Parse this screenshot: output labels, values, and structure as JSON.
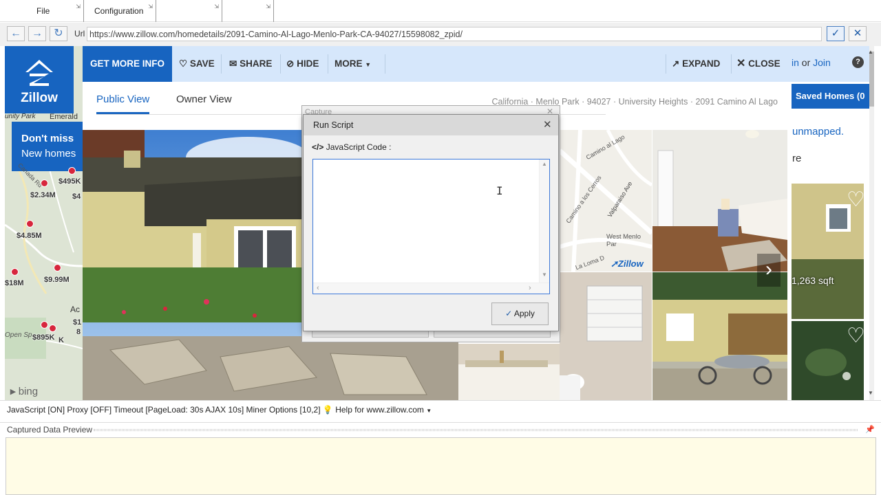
{
  "menu": {
    "file": "File",
    "configuration": "Configuration"
  },
  "address": {
    "label": "Url",
    "url": "https://www.zillow.com/homedetails/2091-Camino-Al-Lago-Menlo-Park-CA-94027/15598082_zpid/"
  },
  "zillow": {
    "logo_text": "Zillow",
    "actions": {
      "get_more_info": "GET MORE INFO",
      "save": "SAVE",
      "share": "SHARE",
      "hide": "HIDE",
      "more": "MORE",
      "expand": "EXPAND",
      "close": "CLOSE"
    },
    "tabs": {
      "public": "Public View",
      "owner": "Owner View"
    },
    "breadcrumb": "California · Menlo Park · 94027 · University Heights · 2091 Camino Al Lago",
    "signin_or": "or",
    "signin_suffix": "in",
    "join": "Join",
    "saved_homes": "Saved Homes (0",
    "unmapped": "unmapped.",
    "re": "re",
    "sqft": "1,263 sqft",
    "help_glyph": "?"
  },
  "map": {
    "banner_line1": "Don't miss",
    "banner_line2": "New homes",
    "place_emerald": "Emerald",
    "place_unity": "unity Park",
    "road": "Canada Rd",
    "prices": [
      "$495K",
      "$2.34M",
      "$4",
      "$4.85M",
      "$18M",
      "$9.99M",
      "$1",
      "8",
      "$895K",
      "K"
    ],
    "place_ac": "Ac",
    "place_opensp": "Open Sp",
    "bing": "bing"
  },
  "street_map": {
    "camino": "Camino al Lago",
    "cerros": "Camino a los Cerros",
    "valparaiso": "Valparaiso Ave",
    "west_menlo": "West Menlo Par",
    "loma": "La Loma D",
    "watermark": "Zillow"
  },
  "capture_dialog": {
    "title": "Capture"
  },
  "run_script": {
    "title": "Run Script",
    "section_label": "JavaScript Code :",
    "code": "",
    "apply": "Apply"
  },
  "status": {
    "text": "JavaScript [ON] Proxy [OFF] Timeout [PageLoad: 30s AJAX 10s] Miner Options [10,2]",
    "help": "Help for www.zillow.com"
  },
  "preview": {
    "title": "Captured Data Preview"
  },
  "colors": {
    "zillow_blue": "#1764c0",
    "pin_red": "#d7263d",
    "preview_bg": "#fffce6"
  }
}
